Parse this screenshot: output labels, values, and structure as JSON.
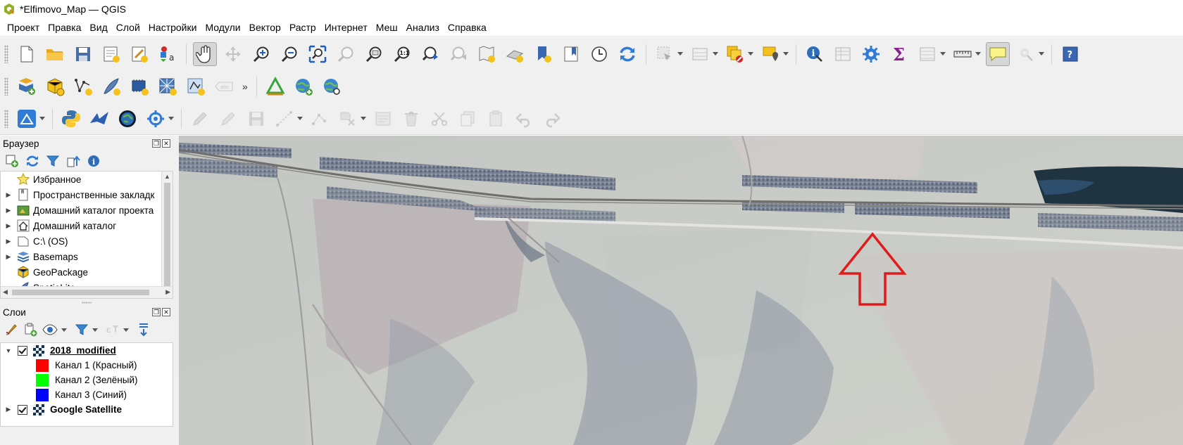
{
  "window": {
    "title": "*Elfimovo_Map — QGIS"
  },
  "menubar": [
    "Проект",
    "Правка",
    "Вид",
    "Слой",
    "Настройки",
    "Модули",
    "Вектор",
    "Растр",
    "Интернет",
    "Меш",
    "Анализ",
    "Справка"
  ],
  "browser_panel": {
    "title": "Браузер",
    "items": [
      {
        "label": "Избранное",
        "icon": "star-icon",
        "expandable": false
      },
      {
        "label": "Пространственные закладк",
        "icon": "bookmarks-icon",
        "expandable": true
      },
      {
        "label": "Домашний каталог проекта",
        "icon": "project-home-icon",
        "expandable": true
      },
      {
        "label": "Домашний каталог",
        "icon": "home-icon",
        "expandable": true
      },
      {
        "label": "C:\\ (OS)",
        "icon": "drive-icon",
        "expandable": true
      },
      {
        "label": "Basemaps",
        "icon": "basemaps-icon",
        "expandable": true
      },
      {
        "label": "GeoPackage",
        "icon": "geopackage-icon",
        "expandable": false
      },
      {
        "label": "SpatiaLite",
        "icon": "spatialite-icon",
        "expandable": false
      }
    ]
  },
  "layers_panel": {
    "title": "Слои",
    "layers": [
      {
        "name": "2018_modified",
        "checked": true,
        "expanded": true,
        "bands": [
          {
            "label": "Канал 1 (Красный)",
            "color": "#ff0000"
          },
          {
            "label": "Канал 2 (Зелёный)",
            "color": "#00ff00"
          },
          {
            "label": "Канал 3 (Синий)",
            "color": "#0000ff"
          }
        ]
      },
      {
        "name": "Google Satellite",
        "checked": true,
        "expanded": false,
        "bands": []
      }
    ]
  },
  "toolbar1": [
    "new-project-icon",
    "open-project-icon",
    "save-project-icon",
    "new-print-layout-icon",
    "style-manager-icon",
    "identify-style-icon",
    "pan-icon",
    "pan-to-selection-icon",
    "zoom-in-icon",
    "zoom-out-icon",
    "zoom-full-icon",
    "zoom-to-selection-icon",
    "zoom-to-layer-icon",
    "zoom-native-icon",
    "zoom-last-icon",
    "zoom-next-icon",
    "new-map-view-icon",
    "new-3d-view-icon",
    "temporal-icon",
    "bookmarks-icon",
    "show-bookmarks-icon",
    "time-controller-icon",
    "refresh-icon",
    "select-features-icon",
    "open-attribute-table-icon",
    "deselect-icon",
    "select-location-icon",
    "identify-icon",
    "attribute-table-icon",
    "processing-toolbox-icon",
    "statistics-icon",
    "field-calculator-icon",
    "measure-icon",
    "map-tips-icon",
    "annotation-icon",
    "help-icon"
  ],
  "toolbar2_more": "»",
  "toolbar1_active_label": "pan",
  "map_annotation": {
    "arrow_color": "#e01b1b"
  }
}
